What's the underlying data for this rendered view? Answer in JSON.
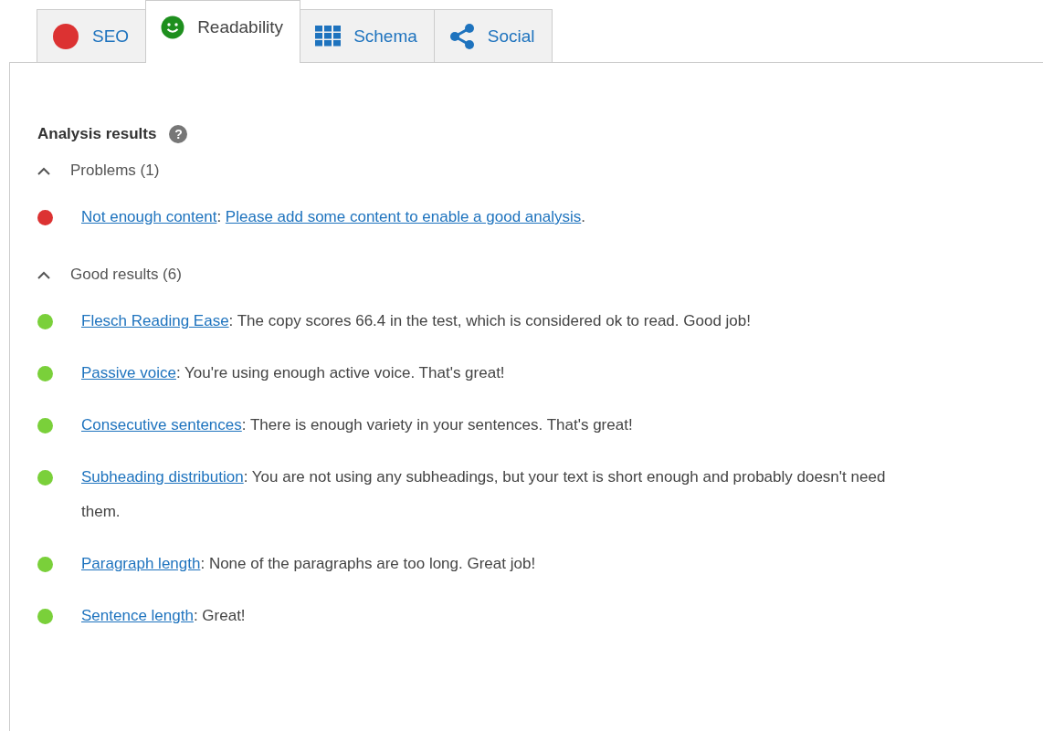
{
  "tabs": [
    {
      "label": "SEO",
      "kind": "dot",
      "selected": false
    },
    {
      "label": "Readability",
      "kind": "smiley",
      "selected": true
    },
    {
      "label": "Schema",
      "kind": "grid",
      "selected": false
    },
    {
      "label": "Social",
      "kind": "share",
      "selected": false
    }
  ],
  "panel": {
    "title": "Analysis results",
    "help_icon": "?",
    "sections": [
      {
        "heading": "Problems (1)",
        "expanded": true,
        "items": [
          {
            "color": "#dc3232",
            "segments": [
              {
                "kind": "link",
                "text": "Not enough content"
              },
              {
                "kind": "plain",
                "text": ": "
              },
              {
                "kind": "link",
                "text": "Please add some content to enable a good analysis"
              },
              {
                "kind": "plain",
                "text": "."
              }
            ]
          }
        ]
      },
      {
        "heading": "Good results (6)",
        "expanded": true,
        "items": [
          {
            "color": "#7ad03a",
            "segments": [
              {
                "kind": "link",
                "text": "Flesch Reading Ease"
              },
              {
                "kind": "plain",
                "text": ": The copy scores 66.4 in the test, which is considered ok to read. Good job!"
              }
            ]
          },
          {
            "color": "#7ad03a",
            "segments": [
              {
                "kind": "link",
                "text": "Passive voice"
              },
              {
                "kind": "plain",
                "text": ": You're using enough active voice. That's great!"
              }
            ]
          },
          {
            "color": "#7ad03a",
            "segments": [
              {
                "kind": "link",
                "text": "Consecutive sentences"
              },
              {
                "kind": "plain",
                "text": ": There is enough variety in your sentences. That's great!"
              }
            ]
          },
          {
            "color": "#7ad03a",
            "segments": [
              {
                "kind": "link",
                "text": "Subheading distribution"
              },
              {
                "kind": "plain",
                "text": ": You are not using any subheadings, but your text is short enough and probably doesn't need them."
              }
            ]
          },
          {
            "color": "#7ad03a",
            "segments": [
              {
                "kind": "link",
                "text": "Paragraph length"
              },
              {
                "kind": "plain",
                "text": ": None of the paragraphs are too long. Great job!"
              }
            ]
          },
          {
            "color": "#7ad03a",
            "segments": [
              {
                "kind": "link",
                "text": "Sentence length"
              },
              {
                "kind": "plain",
                "text": ": Great!"
              }
            ]
          }
        ]
      }
    ]
  }
}
